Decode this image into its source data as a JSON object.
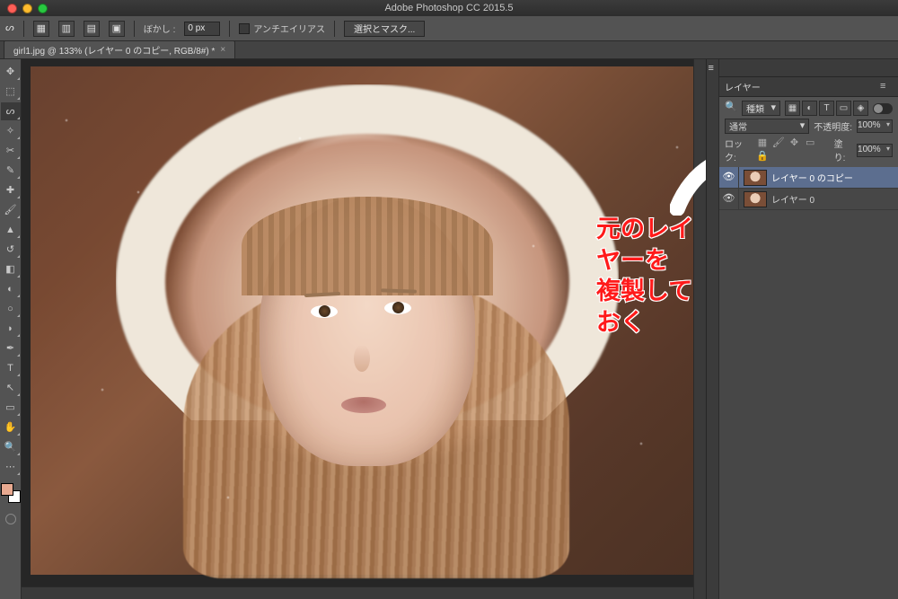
{
  "app": {
    "title": "Adobe Photoshop CC 2015.5"
  },
  "options_bar": {
    "blur_label": "ぼかし :",
    "blur_value": "0 px",
    "antialias_label": "アンチエイリアス",
    "select_mask_btn": "選択とマスク..."
  },
  "document_tab": {
    "label": "girl1.jpg @ 133% (レイヤー 0 のコピー, RGB/8#) *"
  },
  "tools": [
    {
      "name": "move-tool",
      "glyph": "✥"
    },
    {
      "name": "rectangular-marquee-tool",
      "glyph": "⬚"
    },
    {
      "name": "lasso-tool",
      "glyph": "ᔕ",
      "selected": true
    },
    {
      "name": "magic-wand-tool",
      "glyph": "✧"
    },
    {
      "name": "crop-tool",
      "glyph": "✂"
    },
    {
      "name": "eyedropper-tool",
      "glyph": "✎"
    },
    {
      "name": "spot-healing-tool",
      "glyph": "✚"
    },
    {
      "name": "brush-tool",
      "glyph": "🖌"
    },
    {
      "name": "clone-stamp-tool",
      "glyph": "▲"
    },
    {
      "name": "history-brush-tool",
      "glyph": "↺"
    },
    {
      "name": "eraser-tool",
      "glyph": "◧"
    },
    {
      "name": "gradient-tool",
      "glyph": "◐"
    },
    {
      "name": "blur-tool",
      "glyph": "○"
    },
    {
      "name": "dodge-tool",
      "glyph": "◗"
    },
    {
      "name": "pen-tool",
      "glyph": "✒"
    },
    {
      "name": "type-tool",
      "glyph": "T"
    },
    {
      "name": "path-selection-tool",
      "glyph": "↖"
    },
    {
      "name": "rectangle-tool",
      "glyph": "▭"
    },
    {
      "name": "hand-tool",
      "glyph": "✋"
    },
    {
      "name": "zoom-tool",
      "glyph": "🔍"
    },
    {
      "name": "more-tools",
      "glyph": "⋯"
    }
  ],
  "swatches": {
    "fg": "#e8a990",
    "bg": "#ffffff"
  },
  "layers_panel": {
    "title": "レイヤー",
    "kind_filter": "種類",
    "blend_mode": "通常",
    "opacity_label": "不透明度:",
    "opacity_value": "100%",
    "lock_label": "ロック:",
    "fill_label": "塗り:",
    "fill_value": "100%",
    "layers": [
      {
        "name": "レイヤー 0 のコピー",
        "selected": true
      },
      {
        "name": "レイヤー 0",
        "selected": false
      }
    ]
  },
  "annotation": {
    "line1": "元のレイヤーを",
    "line2": "複製しておく"
  }
}
